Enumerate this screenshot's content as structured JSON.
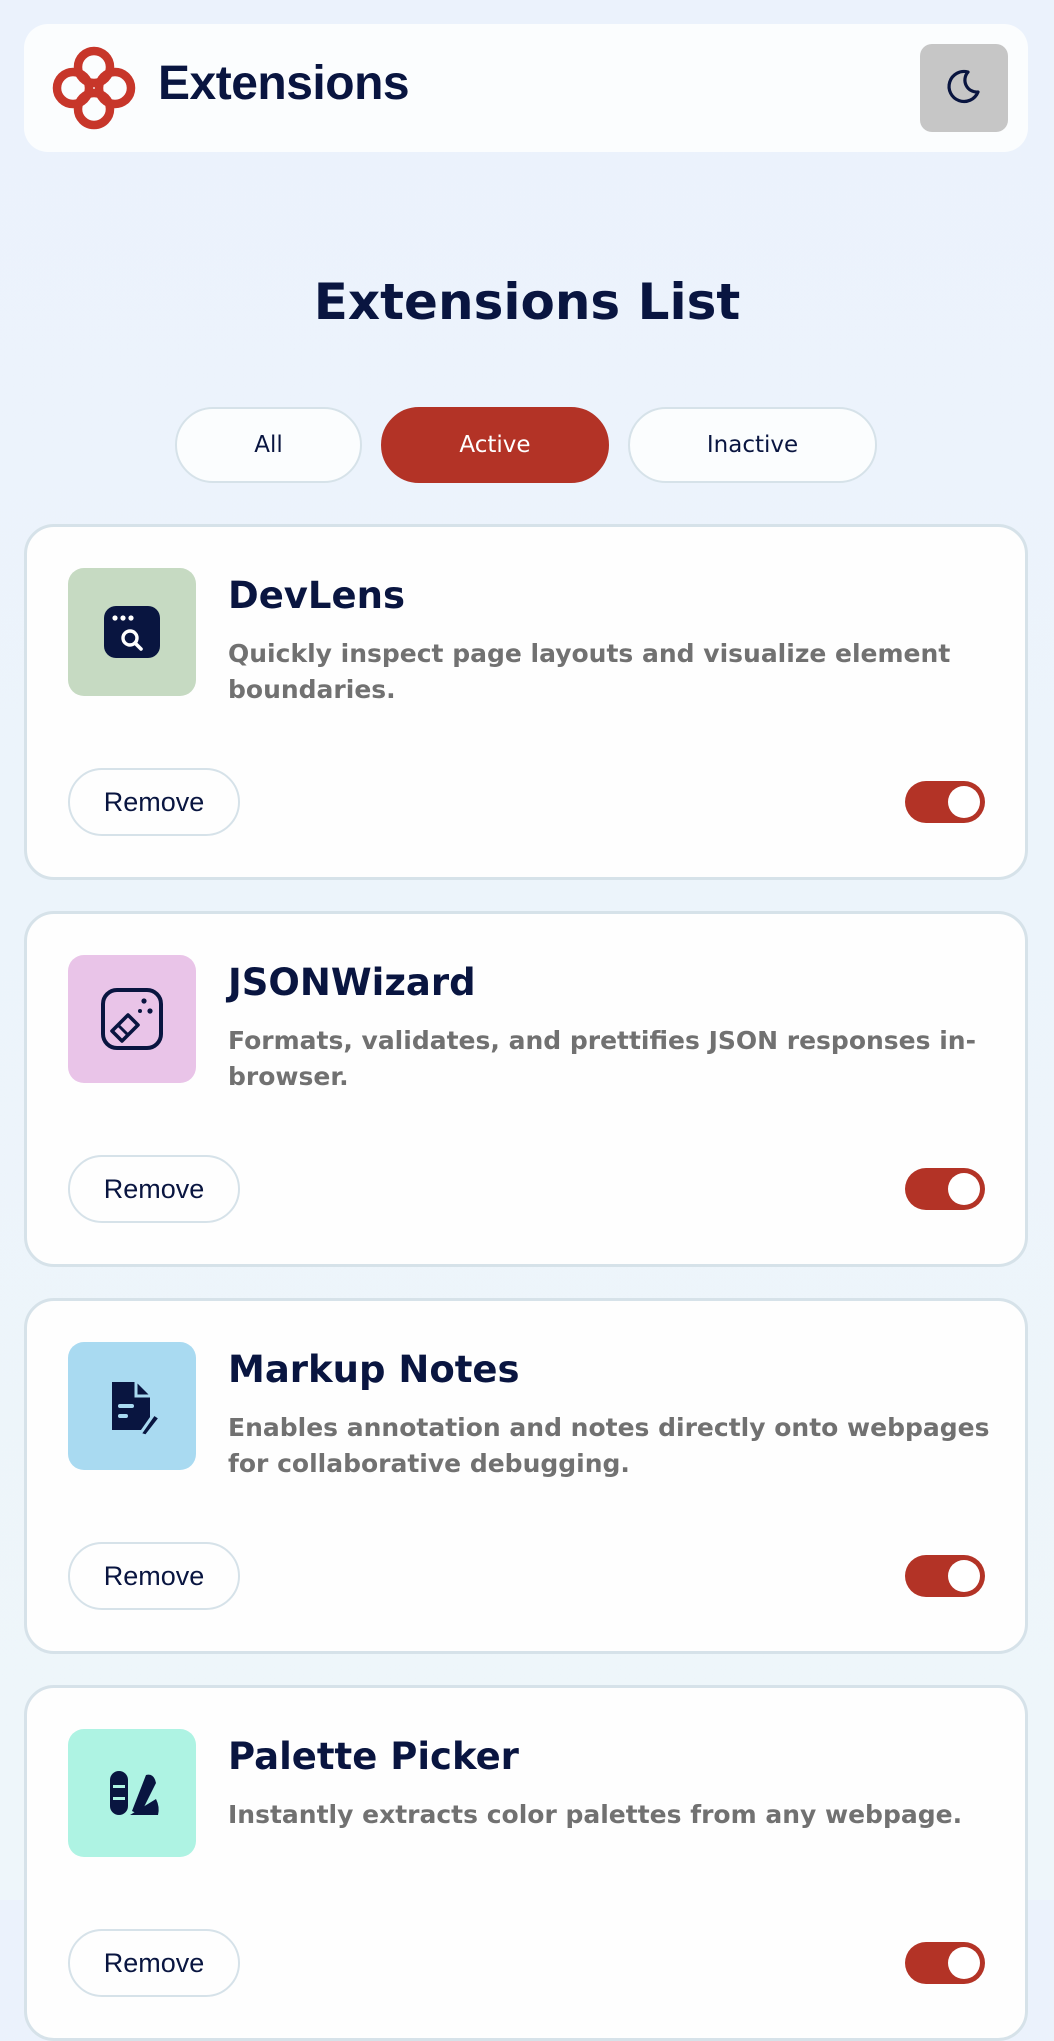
{
  "header": {
    "brand": "Extensions",
    "logo_icon": "extensions-logo-icon",
    "theme_icon": "moon-icon"
  },
  "page": {
    "title": "Extensions List"
  },
  "filters": [
    {
      "label": "All",
      "selected": false
    },
    {
      "label": "Active",
      "selected": true
    },
    {
      "label": "Inactive",
      "selected": false
    }
  ],
  "extensions": [
    {
      "name": "DevLens",
      "description": "Quickly inspect page layouts and visualize element boundaries.",
      "icon": "devlens-icon",
      "icon_bg": "#c6dac2",
      "active": true,
      "remove_label": "Remove"
    },
    {
      "name": "JSONWizard",
      "description": "Formats, validates, and prettifies JSON responses in-browser.",
      "icon": "jsonwizard-icon",
      "icon_bg": "#e9c4e8",
      "active": true,
      "remove_label": "Remove"
    },
    {
      "name": "Markup Notes",
      "description": "Enables annotation and notes directly onto webpages for collaborative debugging.",
      "icon": "markup-notes-icon",
      "icon_bg": "#a9daf1",
      "active": true,
      "remove_label": "Remove"
    },
    {
      "name": "Palette Picker",
      "description": "Instantly extracts color palettes from any webpage.",
      "icon": "palette-picker-icon",
      "icon_bg": "#aef3e3",
      "active": true,
      "remove_label": "Remove"
    }
  ],
  "colors": {
    "accent": "#b33326",
    "text_dark": "#091540",
    "text_muted": "#717171",
    "border": "#d6e2e9"
  }
}
